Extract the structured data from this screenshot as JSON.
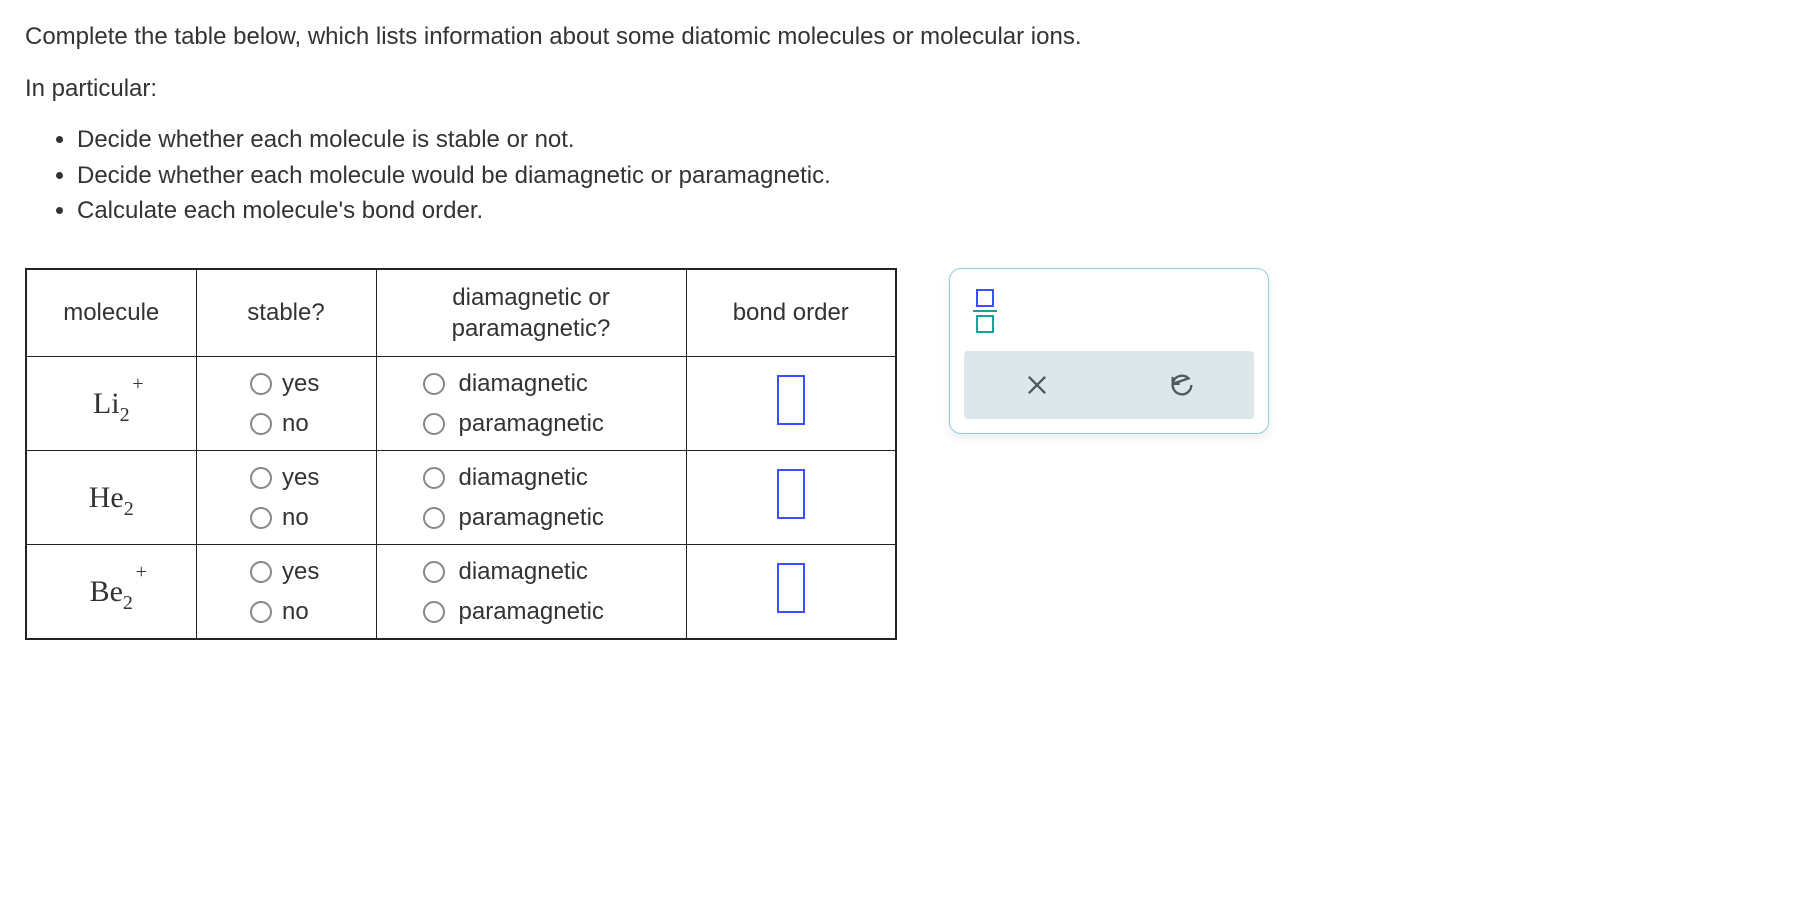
{
  "intro": {
    "line1": "Complete the table below, which lists information about some diatomic molecules or molecular ions.",
    "line2": "In particular:",
    "bullets": [
      "Decide whether each molecule is stable or not.",
      "Decide whether each molecule would be diamagnetic or paramagnetic.",
      "Calculate each molecule's bond order."
    ]
  },
  "table": {
    "headers": {
      "molecule": "molecule",
      "stable": "stable?",
      "magnetic": "diamagnetic or paramagnetic?",
      "bond": "bond order"
    },
    "options": {
      "yes": "yes",
      "no": "no",
      "dia": "diamagnetic",
      "para": "paramagnetic"
    },
    "rows": [
      {
        "base": "Li",
        "sub": "2",
        "sup": "+"
      },
      {
        "base": "He",
        "sub": "2",
        "sup": ""
      },
      {
        "base": "Be",
        "sub": "2",
        "sup": "+"
      }
    ]
  }
}
